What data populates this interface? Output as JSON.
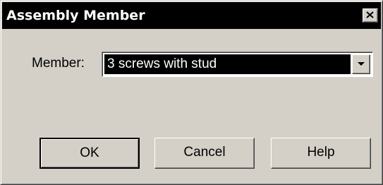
{
  "window": {
    "title": "Assembly Member"
  },
  "form": {
    "member_label": "Member:",
    "member_value": "3 screws with stud"
  },
  "buttons": {
    "ok_label": "OK",
    "cancel_label": "Cancel",
    "help_label": "Help"
  },
  "icons": {
    "close": "close-icon",
    "dropdown": "chevron-down-icon"
  },
  "colors": {
    "titlebar": "#000000",
    "dialog_face": "#d4d0c8",
    "selection_bg": "#000000",
    "selection_text": "#ffffff"
  }
}
